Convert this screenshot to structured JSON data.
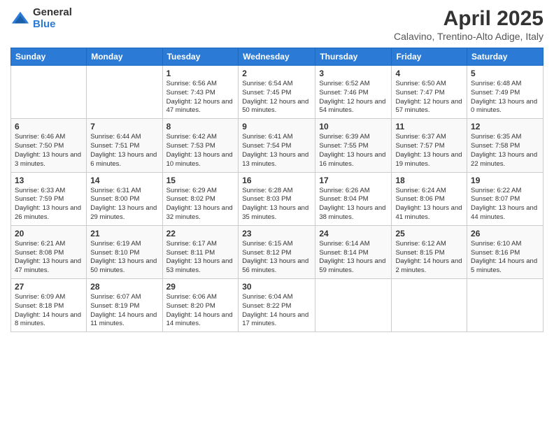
{
  "logo": {
    "general": "General",
    "blue": "Blue"
  },
  "title": "April 2025",
  "subtitle": "Calavino, Trentino-Alto Adige, Italy",
  "days": [
    "Sunday",
    "Monday",
    "Tuesday",
    "Wednesday",
    "Thursday",
    "Friday",
    "Saturday"
  ],
  "weeks": [
    [
      {
        "num": "",
        "info": ""
      },
      {
        "num": "",
        "info": ""
      },
      {
        "num": "1",
        "info": "Sunrise: 6:56 AM\nSunset: 7:43 PM\nDaylight: 12 hours and 47 minutes."
      },
      {
        "num": "2",
        "info": "Sunrise: 6:54 AM\nSunset: 7:45 PM\nDaylight: 12 hours and 50 minutes."
      },
      {
        "num": "3",
        "info": "Sunrise: 6:52 AM\nSunset: 7:46 PM\nDaylight: 12 hours and 54 minutes."
      },
      {
        "num": "4",
        "info": "Sunrise: 6:50 AM\nSunset: 7:47 PM\nDaylight: 12 hours and 57 minutes."
      },
      {
        "num": "5",
        "info": "Sunrise: 6:48 AM\nSunset: 7:49 PM\nDaylight: 13 hours and 0 minutes."
      }
    ],
    [
      {
        "num": "6",
        "info": "Sunrise: 6:46 AM\nSunset: 7:50 PM\nDaylight: 13 hours and 3 minutes."
      },
      {
        "num": "7",
        "info": "Sunrise: 6:44 AM\nSunset: 7:51 PM\nDaylight: 13 hours and 6 minutes."
      },
      {
        "num": "8",
        "info": "Sunrise: 6:42 AM\nSunset: 7:53 PM\nDaylight: 13 hours and 10 minutes."
      },
      {
        "num": "9",
        "info": "Sunrise: 6:41 AM\nSunset: 7:54 PM\nDaylight: 13 hours and 13 minutes."
      },
      {
        "num": "10",
        "info": "Sunrise: 6:39 AM\nSunset: 7:55 PM\nDaylight: 13 hours and 16 minutes."
      },
      {
        "num": "11",
        "info": "Sunrise: 6:37 AM\nSunset: 7:57 PM\nDaylight: 13 hours and 19 minutes."
      },
      {
        "num": "12",
        "info": "Sunrise: 6:35 AM\nSunset: 7:58 PM\nDaylight: 13 hours and 22 minutes."
      }
    ],
    [
      {
        "num": "13",
        "info": "Sunrise: 6:33 AM\nSunset: 7:59 PM\nDaylight: 13 hours and 26 minutes."
      },
      {
        "num": "14",
        "info": "Sunrise: 6:31 AM\nSunset: 8:00 PM\nDaylight: 13 hours and 29 minutes."
      },
      {
        "num": "15",
        "info": "Sunrise: 6:29 AM\nSunset: 8:02 PM\nDaylight: 13 hours and 32 minutes."
      },
      {
        "num": "16",
        "info": "Sunrise: 6:28 AM\nSunset: 8:03 PM\nDaylight: 13 hours and 35 minutes."
      },
      {
        "num": "17",
        "info": "Sunrise: 6:26 AM\nSunset: 8:04 PM\nDaylight: 13 hours and 38 minutes."
      },
      {
        "num": "18",
        "info": "Sunrise: 6:24 AM\nSunset: 8:06 PM\nDaylight: 13 hours and 41 minutes."
      },
      {
        "num": "19",
        "info": "Sunrise: 6:22 AM\nSunset: 8:07 PM\nDaylight: 13 hours and 44 minutes."
      }
    ],
    [
      {
        "num": "20",
        "info": "Sunrise: 6:21 AM\nSunset: 8:08 PM\nDaylight: 13 hours and 47 minutes."
      },
      {
        "num": "21",
        "info": "Sunrise: 6:19 AM\nSunset: 8:10 PM\nDaylight: 13 hours and 50 minutes."
      },
      {
        "num": "22",
        "info": "Sunrise: 6:17 AM\nSunset: 8:11 PM\nDaylight: 13 hours and 53 minutes."
      },
      {
        "num": "23",
        "info": "Sunrise: 6:15 AM\nSunset: 8:12 PM\nDaylight: 13 hours and 56 minutes."
      },
      {
        "num": "24",
        "info": "Sunrise: 6:14 AM\nSunset: 8:14 PM\nDaylight: 13 hours and 59 minutes."
      },
      {
        "num": "25",
        "info": "Sunrise: 6:12 AM\nSunset: 8:15 PM\nDaylight: 14 hours and 2 minutes."
      },
      {
        "num": "26",
        "info": "Sunrise: 6:10 AM\nSunset: 8:16 PM\nDaylight: 14 hours and 5 minutes."
      }
    ],
    [
      {
        "num": "27",
        "info": "Sunrise: 6:09 AM\nSunset: 8:18 PM\nDaylight: 14 hours and 8 minutes."
      },
      {
        "num": "28",
        "info": "Sunrise: 6:07 AM\nSunset: 8:19 PM\nDaylight: 14 hours and 11 minutes."
      },
      {
        "num": "29",
        "info": "Sunrise: 6:06 AM\nSunset: 8:20 PM\nDaylight: 14 hours and 14 minutes."
      },
      {
        "num": "30",
        "info": "Sunrise: 6:04 AM\nSunset: 8:22 PM\nDaylight: 14 hours and 17 minutes."
      },
      {
        "num": "",
        "info": ""
      },
      {
        "num": "",
        "info": ""
      },
      {
        "num": "",
        "info": ""
      }
    ]
  ]
}
